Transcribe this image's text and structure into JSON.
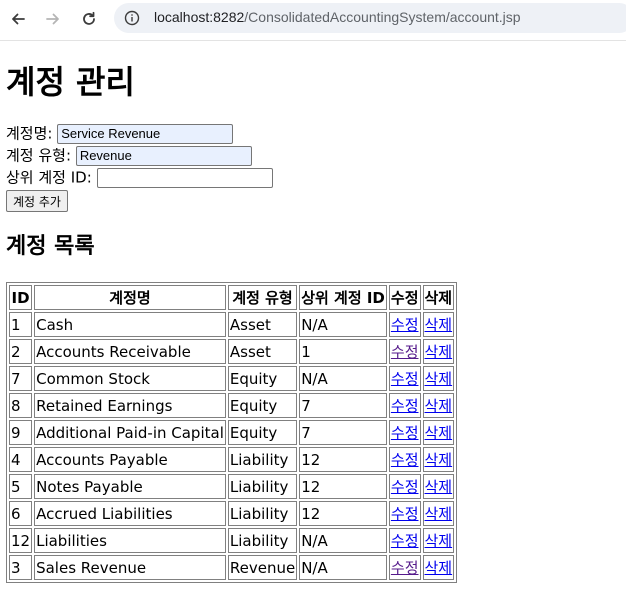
{
  "browser": {
    "url_host": "localhost:8282",
    "url_path": "/ConsolidatedAccountingSystem/account.jsp"
  },
  "page": {
    "title": "계정 관리",
    "list_title": "계정 목록"
  },
  "form": {
    "name_label": "계정명:",
    "name_value": "Service Revenue",
    "type_label": "계정 유형:",
    "type_value": "Revenue",
    "parent_label": "상위 계정 ID:",
    "parent_value": "",
    "submit_label": "계정 추가"
  },
  "table": {
    "headers": [
      "ID",
      "계정명",
      "계정 유형",
      "상위 계정 ID",
      "수정",
      "삭제"
    ],
    "edit_label": "수정",
    "delete_label": "삭제",
    "rows": [
      {
        "id": "1",
        "name": "Cash",
        "type": "Asset",
        "parent": "N/A"
      },
      {
        "id": "2",
        "name": "Accounts Receivable",
        "type": "Asset",
        "parent": "1"
      },
      {
        "id": "7",
        "name": "Common Stock",
        "type": "Equity",
        "parent": "N/A"
      },
      {
        "id": "8",
        "name": "Retained Earnings",
        "type": "Equity",
        "parent": "7"
      },
      {
        "id": "9",
        "name": "Additional Paid-in Capital",
        "type": "Equity",
        "parent": "7"
      },
      {
        "id": "4",
        "name": "Accounts Payable",
        "type": "Liability",
        "parent": "12"
      },
      {
        "id": "5",
        "name": "Notes Payable",
        "type": "Liability",
        "parent": "12"
      },
      {
        "id": "6",
        "name": "Accrued Liabilities",
        "type": "Liability",
        "parent": "12"
      },
      {
        "id": "12",
        "name": "Liabilities",
        "type": "Liability",
        "parent": "N/A"
      },
      {
        "id": "3",
        "name": "Sales Revenue",
        "type": "Revenue",
        "parent": "N/A"
      }
    ]
  },
  "colors": {
    "link": "#0000ee",
    "visited_link": "#551a8b",
    "autofill_bg": "#e8f0fe"
  },
  "icons": {
    "back": "back-arrow-icon",
    "forward": "forward-arrow-icon",
    "reload": "reload-icon",
    "site_info": "site-info-icon"
  }
}
